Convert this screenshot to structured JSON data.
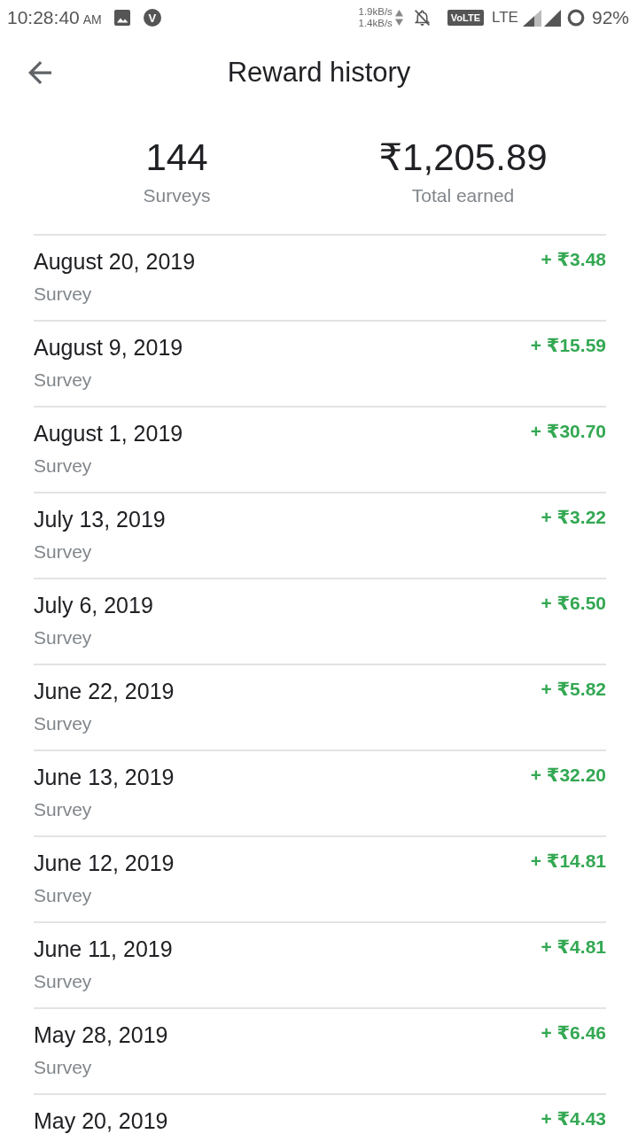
{
  "status_bar": {
    "time": "10:28:40",
    "meridiem": "AM",
    "app_notification": "V",
    "speed_up": "1.9kB/s",
    "speed_down": "1.4kB/s",
    "volte": "VoLTE",
    "network": "LTE",
    "battery": "92%"
  },
  "app_bar": {
    "title": "Reward history"
  },
  "summary": [
    {
      "value": "144",
      "label": "Surveys"
    },
    {
      "value": "₹1,205.89",
      "label": "Total earned"
    }
  ],
  "rewards": [
    {
      "date": "August 20, 2019",
      "type": "Survey",
      "amount": "+ ₹3.48"
    },
    {
      "date": "August 9, 2019",
      "type": "Survey",
      "amount": "+ ₹15.59"
    },
    {
      "date": "August 1, 2019",
      "type": "Survey",
      "amount": "+ ₹30.70"
    },
    {
      "date": "July 13, 2019",
      "type": "Survey",
      "amount": "+ ₹3.22"
    },
    {
      "date": "July 6, 2019",
      "type": "Survey",
      "amount": "+ ₹6.50"
    },
    {
      "date": "June 22, 2019",
      "type": "Survey",
      "amount": "+ ₹5.82"
    },
    {
      "date": "June 13, 2019",
      "type": "Survey",
      "amount": "+ ₹32.20"
    },
    {
      "date": "June 12, 2019",
      "type": "Survey",
      "amount": "+ ₹14.81"
    },
    {
      "date": "June 11, 2019",
      "type": "Survey",
      "amount": "+ ₹4.81"
    },
    {
      "date": "May 28, 2019",
      "type": "Survey",
      "amount": "+ ₹6.46"
    },
    {
      "date": "May 20, 2019",
      "amount": "+ ₹4.43"
    }
  ]
}
